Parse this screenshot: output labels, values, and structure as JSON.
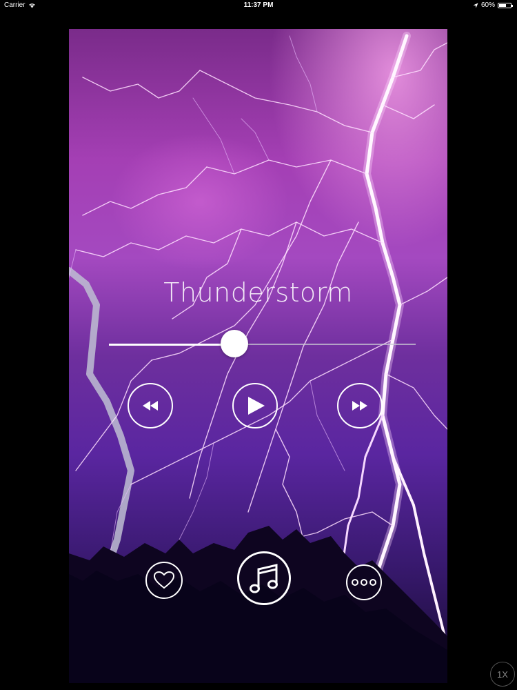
{
  "status_bar": {
    "carrier": "Carrier",
    "time": "11:37 PM",
    "battery_percent": "60%",
    "battery_level": 0.6,
    "icons": [
      "wifi-icon",
      "location-arrow-icon",
      "battery-icon"
    ]
  },
  "player": {
    "track_title": "Thunderstorm",
    "progress": 0.41,
    "controls": {
      "rewind_icon": "rewind-icon",
      "play_icon": "play-icon",
      "forward_icon": "fast-forward-icon"
    },
    "bottom_bar": {
      "favorite_icon": "heart-icon",
      "music_icon": "music-note-icon",
      "mix_icon": "mixer-icon"
    }
  },
  "zoom_badge": "1X",
  "colors": {
    "accent": "#ffffff",
    "background": "#000000",
    "sky_purple": "#a449c0",
    "lightning": "#ffe8ff"
  }
}
